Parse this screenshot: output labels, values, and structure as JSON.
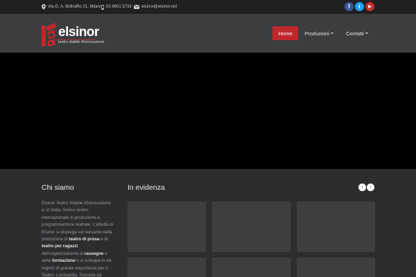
{
  "topbar": {
    "address": "Via G. A. Boltraffio 21, Milano",
    "phone": "02 6901 5733",
    "email": "elsinor@elsinor.net",
    "social": [
      {
        "name": "facebook-icon",
        "glyph": "f",
        "color": "#3b5998"
      },
      {
        "name": "twitter-icon",
        "glyph": "t",
        "color": "#1da1f2"
      },
      {
        "name": "youtube-icon",
        "glyph": "▶",
        "color": "#c4302b"
      }
    ]
  },
  "header": {
    "logo_word": "elsinor",
    "logo_tagline": "teatro stabile d'innovazione",
    "brand_color": "#c0272d"
  },
  "nav": {
    "home": "Home",
    "produzioni": "Produzioni",
    "contatti": "Contatti"
  },
  "about": {
    "title": "Chi siamo",
    "text_1": "Elsinor Teatro Stabile d'Innovazione è, in Italia, l'unico centro internazionale di produzione e programmazione teatrale. L'attività di Elsinor si dispiega sul versante della produzione di ",
    "bold_1": "teatro di prosa",
    "text_2": " e di ",
    "bold_2": "teatro per ragazzi",
    "text_3": ", dell'organizzazione di ",
    "bold_3": "rassegne",
    "text_4": " e della ",
    "bold_4": "formazione",
    "text_5": " e si sviluppa in tre regioni di grande importanza per il Teatro: Lombardia, Toscana ed"
  },
  "featured": {
    "title": "In evidenza",
    "prev_icon": "‹",
    "next_icon": "›"
  }
}
